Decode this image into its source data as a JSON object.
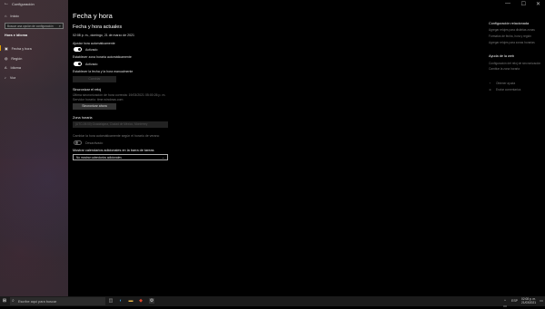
{
  "app": {
    "title": "Configuración",
    "back_glyph": "←"
  },
  "window_controls": [
    "—",
    "☐",
    "✕"
  ],
  "nav": {
    "home": "Inicio",
    "search_placeholder": "Buscar una opción de configuración",
    "section": "Hora e idioma",
    "items": [
      {
        "label": "Fecha y hora",
        "icon": "calendar-clock-icon"
      },
      {
        "label": "Región",
        "icon": "globe-icon"
      },
      {
        "label": "Idioma",
        "icon": "language-icon"
      },
      {
        "label": "Voz",
        "icon": "microphone-icon"
      }
    ]
  },
  "main": {
    "title": "Fecha y hora",
    "subtitle": "Fecha y hora actuales",
    "current_datetime": "02:08 p. m., domingo, 21 de marzo de 2021",
    "auto_time": {
      "label": "Ajustar hora automáticamente",
      "state": "Activado"
    },
    "auto_timezone": {
      "label": "Establecer zona horaria automáticamente",
      "state": "Activado"
    },
    "manual": {
      "label": "Establecer la fecha y la hora manualmente",
      "button": "Cambiar"
    },
    "sync": {
      "heading": "Sincronizar el reloj",
      "line1": "Última sincronización de hora correcta: 19/03/2021 05:00:26 p. m.",
      "line2": "Servidor horario: time.windows.com",
      "button": "Sincronizar ahora"
    },
    "timezone": {
      "heading": "Zona horaria",
      "value": "(UTC-06:00) Guadalajara, Ciudad de México, Monterrey"
    },
    "dst": {
      "label": "Cambiar la hora automáticamente según el horario de verano",
      "state": "Desactivado"
    },
    "calendars": {
      "heading": "Mostrar calendarios adicionales en la barra de tareas",
      "value": "No mostrar calendarios adicionales"
    }
  },
  "right": {
    "related_heading": "Configuración relacionada",
    "related_links": [
      "Agregar relojes para distintas zonas",
      "Formatos de fecha, hora y región",
      "Agregar relojes para zonas horarias"
    ],
    "help_heading": "Ayuda de la web",
    "help_links": [
      "Configuración del reloj de sincronización",
      "Cambiar la zona horaria"
    ],
    "actions": [
      {
        "label": "Obtener ayuda",
        "icon": "help-chat-icon"
      },
      {
        "label": "Enviar comentarios",
        "icon": "feedback-icon"
      }
    ]
  },
  "taskbar": {
    "search_placeholder": "Escribe aquí para buscar",
    "time": "02:08 p. m.",
    "date": "21/03/2021",
    "lang": "ESP"
  }
}
